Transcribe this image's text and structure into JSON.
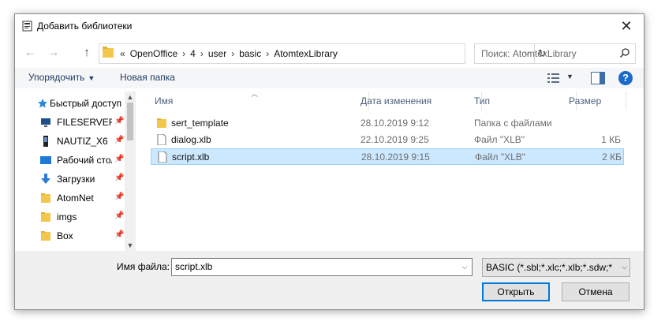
{
  "window": {
    "title": "Добавить библиотеки",
    "close_glyph": "✕"
  },
  "nav": {
    "back_glyph": "←",
    "forward_glyph": "→",
    "up_glyph": "↑"
  },
  "address": {
    "overflow": "«",
    "crumbs": [
      "OpenOffice",
      "4",
      "user",
      "basic",
      "AtomtexLibrary"
    ],
    "separator": "›",
    "dropdown_glyph": "⌵",
    "refresh_glyph": "↻"
  },
  "search": {
    "placeholder": "Поиск: AtomtexLibrary"
  },
  "toolbar": {
    "organize_label": "Упорядочить",
    "new_folder_label": "Новая папка",
    "help_glyph": "?"
  },
  "sidebar": {
    "scroll_up": "▲",
    "scroll_down": "▼",
    "items": [
      {
        "label": "Быстрый доступ",
        "icon": "star-icon",
        "pinned": false
      },
      {
        "label": "FILESERVER",
        "icon": "monitor-icon",
        "pinned": true
      },
      {
        "label": "NAUTIZ_X6",
        "icon": "phone-icon",
        "pinned": true
      },
      {
        "label": "Рабочий стол",
        "icon": "desktop-icon",
        "pinned": true
      },
      {
        "label": "Загрузки",
        "icon": "download-icon",
        "pinned": true
      },
      {
        "label": "AtomNet",
        "icon": "folder-icon",
        "pinned": true
      },
      {
        "label": "imgs",
        "icon": "folder-icon",
        "pinned": true
      },
      {
        "label": "Box",
        "icon": "folder-icon",
        "pinned": true
      }
    ],
    "pin_glyph": "📌"
  },
  "columns": {
    "name": "Имя",
    "date": "Дата изменения",
    "type": "Тип",
    "size": "Размер"
  },
  "files": [
    {
      "name": "sert_template",
      "date": "28.10.2019 9:12",
      "type": "Папка с файлами",
      "size": "",
      "icon": "folder-icon",
      "selected": false
    },
    {
      "name": "dialog.xlb",
      "date": "22.10.2019 9:25",
      "type": "Файл \"XLB\"",
      "size": "1 КБ",
      "icon": "file-icon",
      "selected": false
    },
    {
      "name": "script.xlb",
      "date": "28.10.2019 9:15",
      "type": "Файл \"XLB\"",
      "size": "2 КБ",
      "icon": "file-icon",
      "selected": true
    }
  ],
  "footer": {
    "filename_label": "Имя файла:",
    "filename_value": "script.xlb",
    "filter_value": "BASIC (*.sbl;*.xlc;*.xlb;*.sdw;*.sx",
    "open_label": "Открыть",
    "cancel_label": "Отмена"
  },
  "colors": {
    "accent": "#0078d7",
    "selection": "#cce8ff",
    "selection_border": "#99d1ff",
    "folder": "#f3c74b",
    "link_text": "#1e3a5f"
  }
}
